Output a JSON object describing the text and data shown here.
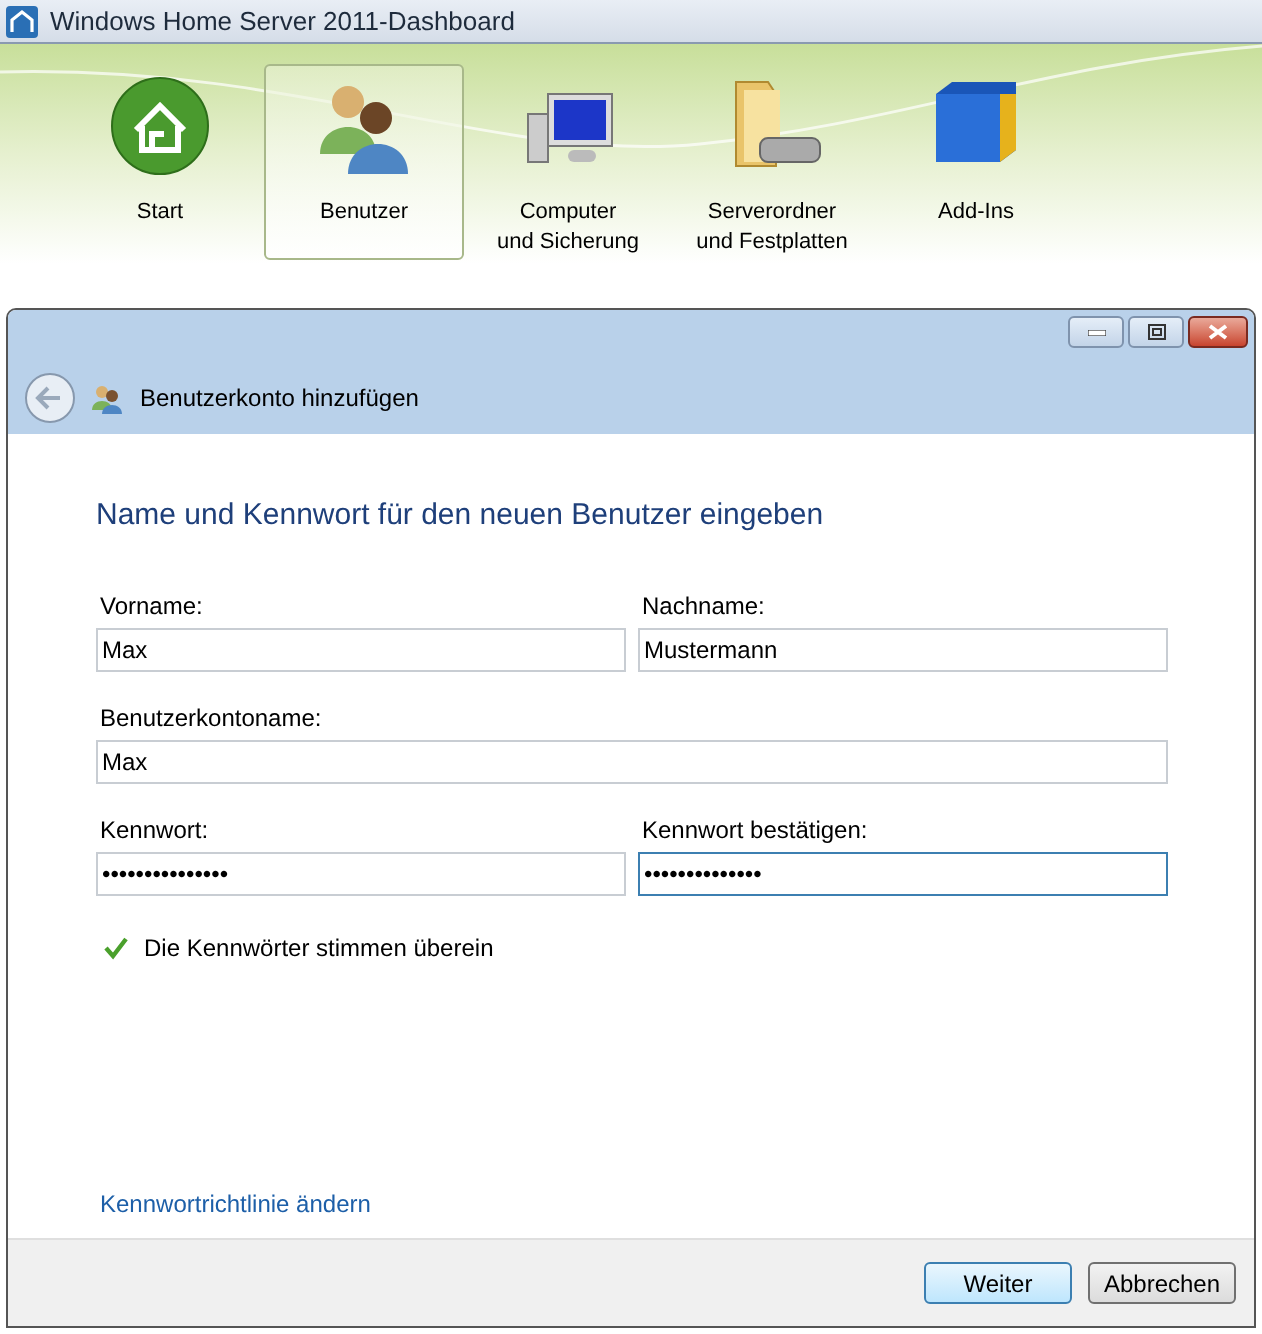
{
  "window": {
    "title": "Windows Home Server 2011-Dashboard"
  },
  "tabs": [
    {
      "kind": "home",
      "label": "Start",
      "selected": false
    },
    {
      "kind": "users",
      "label": "Benutzer",
      "selected": true
    },
    {
      "kind": "computer",
      "label": "Computer\nund Sicherung",
      "selected": false
    },
    {
      "kind": "folder",
      "label": "Serverordner\nund Festplatten",
      "selected": false
    },
    {
      "kind": "addin",
      "label": "Add-Ins",
      "selected": false
    }
  ],
  "dialog": {
    "title": "Benutzerkonto hinzufügen",
    "heading": "Name und Kennwort für den neuen Benutzer eingeben",
    "rows": [
      [
        {
          "label": "Vorname:",
          "value": "Max",
          "focused": false
        },
        {
          "label": "Nachname:",
          "value": "Mustermann",
          "focused": false
        }
      ],
      [
        {
          "label": "Benutzerkontoname:",
          "value": "Max",
          "focused": false
        }
      ],
      [
        {
          "label": "Kennwort:",
          "value": "•••••••••••••••",
          "focused": false
        },
        {
          "label": "Kennwort bestätigen:",
          "value": "••••••••••••••",
          "focused": true
        }
      ]
    ],
    "match_message": "Die Kennwörter stimmen überein",
    "policy_link": "Kennwortrichtlinie ändern",
    "buttons": [
      {
        "label": "Weiter",
        "default": true
      },
      {
        "label": "Abbrechen",
        "default": false
      }
    ]
  }
}
